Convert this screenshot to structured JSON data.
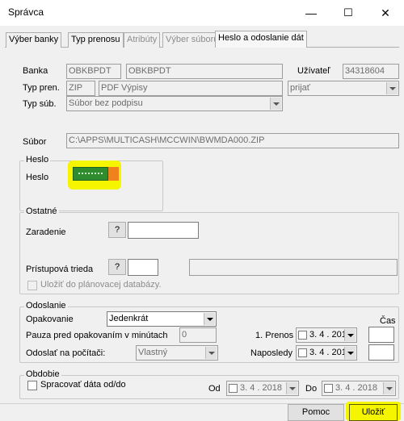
{
  "window": {
    "title": "Správca",
    "minimize": "—",
    "maximize": "☐",
    "close": "✕"
  },
  "tabs": [
    {
      "label": "Výber banky"
    },
    {
      "label": "Typ prenosu"
    },
    {
      "label": "Atribúty"
    },
    {
      "label": "Výber súboru"
    },
    {
      "label": "Heslo a odoslanie dát"
    }
  ],
  "form": {
    "banka_label": "Banka",
    "banka_code": "OBKBPDT",
    "banka_name": "OBKBPDT",
    "uzivatel_label": "Užívateľ",
    "uzivatel_value": "34318604",
    "typ_pren_label": "Typ pren.",
    "typ_pren_code": "ZIP",
    "typ_pren_name": "PDF Výpisy",
    "direction_value": "prijať",
    "typ_sub_label": "Typ súb.",
    "typ_sub_value": "Súbor bez podpisu",
    "subor_label": "Súbor",
    "subor_value": "C:\\APPS\\MULTICASH\\MCCWIN\\BWMDA000.ZIP"
  },
  "heslo": {
    "group_title": "Heslo",
    "label": "Heslo",
    "highlight_color": "#f5f500",
    "field_color": "#2e8b2e"
  },
  "ostatne": {
    "group_title": "Ostatné",
    "zaradenie_label": "Zaradenie",
    "zaradenie_button": "?",
    "zaradenie_value": "",
    "pristupova_label": "Prístupová trieda",
    "pristupova_button": "?",
    "pristupova_value": "",
    "ulozit_db_label": "Uložiť do plánovacej databázy."
  },
  "odoslanie": {
    "group_title": "Odoslanie",
    "opakovanie_label": "Opakovanie",
    "opakovanie_value": "Jedenkrát",
    "cas_label": "Čas",
    "pauza_label": "Pauza pred opakovaním v minútach",
    "pauza_value": "0",
    "prenos1_label": "1. Prenos",
    "prenos1_value": "3. 4 . 201",
    "odoslat_label": "Odoslať na počítači:",
    "odoslat_value": "Vlastný",
    "naposledy_label": "Naposledy",
    "naposledy_value": "3. 4 . 201"
  },
  "obdobie": {
    "group_title": "Obdobie",
    "spracovat_label": "Spracovať dáta od/do",
    "od_label": "Od",
    "od_value": "3. 4 . 2018",
    "do_label": "Do",
    "do_value": "3. 4 . 2018"
  },
  "buttons": {
    "pomoc": "Pomoc",
    "ulozit": "Uložiť"
  }
}
